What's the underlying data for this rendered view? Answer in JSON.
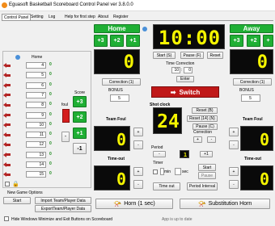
{
  "window": {
    "title": "Eguasoft Basketball Scoreboard Control Panel ver 3.8.0.0"
  },
  "menu": [
    "Settings",
    "Help for first step",
    "About",
    "Register"
  ],
  "tabs": [
    "Control Panel",
    "Setting",
    "Log"
  ],
  "home": {
    "title": "Home",
    "plus3": "+3",
    "plus2": "+2",
    "score": "0",
    "correction": "Correction (1)",
    "bonus_label": "BONUS",
    "bonus_value": "5",
    "team_foul_label": "Team Foul",
    "team_foul": "0",
    "timeout_label": "Time-out",
    "timeout": "0"
  },
  "away": {
    "title": "Away",
    "plus3": "+3",
    "plus2": "+2",
    "score": "0",
    "correction": "Correction (1)",
    "bonus_label": "BONUS",
    "bonus_value": "5",
    "team_foul_label": "Team Foul",
    "team_foul": "0",
    "timeout_label": "Time-out",
    "timeout": "0"
  },
  "clock": {
    "time": "10:00",
    "start": "Start (S)",
    "pause": "Pause (F)",
    "reset": "Reset",
    "correction_label": "Time Correction",
    "min": "10",
    "sec": "0",
    "enter": "Enter"
  },
  "switch_label": "Switch",
  "shot_clock": {
    "label": "Shot clock",
    "value": "24",
    "reset_b": "Reset (B)",
    "reset_14": "Reset (14) (N)",
    "pause_c": "Pause (C)",
    "correction_label": "Correction",
    "plus": "+",
    "minus": "-"
  },
  "period": {
    "label": "Period",
    "minus": "-",
    "value": "1",
    "plus1": "+1"
  },
  "timer": {
    "label": "Timer",
    "min": "min",
    "sec": "sec",
    "start": "Start",
    "pause": "Pause",
    "timeout": "Time out",
    "interval": "Period Interval"
  },
  "team_panel": {
    "home_label": "Home",
    "players": [
      "4",
      "5",
      "6",
      "7",
      "8",
      "9",
      "10",
      "11",
      "12",
      "13",
      "14",
      "15"
    ],
    "fouls": [
      "0",
      "0",
      "0",
      "0",
      "0",
      "0",
      "0",
      "0",
      "0",
      "0",
      "0",
      "0"
    ],
    "foul_label": "foul",
    "score_label": "Score",
    "plus3": "+3",
    "plus2": "+2",
    "plus1": "+1",
    "minus1": "-1",
    "minus": "-"
  },
  "game_options": {
    "label": "New Game Options",
    "start": "Start",
    "import": "Import Team/Player Data",
    "export": "ExportTeam/Player Data"
  },
  "horn": {
    "horn": "Horn (1 sec)",
    "substitution": "Substitution Horn"
  },
  "status": {
    "hide": "Hide Windows Minimize and Exit Buttons on Scoreboard",
    "app": "App is up to date"
  },
  "colors": {
    "green": "#1faf34",
    "red_switch": "#c01818",
    "segment": "#f4f400"
  }
}
